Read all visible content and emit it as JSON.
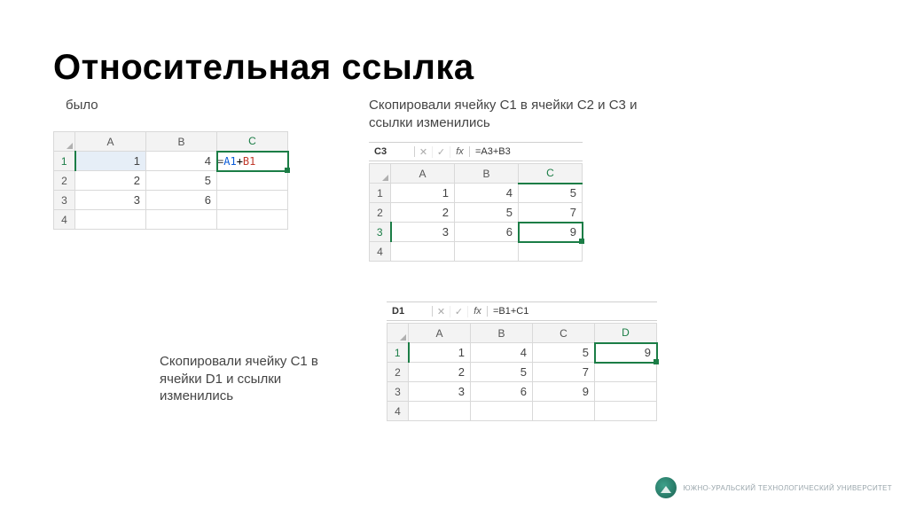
{
  "title": "Относительная ссылка",
  "captions": {
    "was": "было",
    "copied_c2c3": "Скопировали ячейку С1 в ячейки С2 и С3 и ссылки изменились",
    "copied_d1": "Скопировали ячейку С1 в ячейки D1 и ссылки изменились"
  },
  "ex1": {
    "cols": [
      "A",
      "B",
      "C"
    ],
    "rows": [
      "1",
      "2",
      "3",
      "4"
    ],
    "data": [
      [
        "1",
        "4",
        "=A1+B1"
      ],
      [
        "2",
        "5",
        ""
      ],
      [
        "3",
        "6",
        ""
      ],
      [
        "",
        "",
        ""
      ]
    ],
    "formula_parts": {
      "eq": "=",
      "r1": "A1",
      "plus": "+",
      "r2": "B1"
    }
  },
  "ex2": {
    "namebox": "C3",
    "formula": "=A3+B3",
    "cols": [
      "A",
      "B",
      "C"
    ],
    "rows": [
      "1",
      "2",
      "3",
      "4"
    ],
    "data": [
      [
        "1",
        "4",
        "5"
      ],
      [
        "2",
        "5",
        "7"
      ],
      [
        "3",
        "6",
        "9"
      ],
      [
        "",
        "",
        ""
      ]
    ]
  },
  "ex3": {
    "namebox": "D1",
    "formula": "=B1+C1",
    "cols": [
      "A",
      "B",
      "C",
      "D"
    ],
    "rows": [
      "1",
      "2",
      "3",
      "4"
    ],
    "data": [
      [
        "1",
        "4",
        "5",
        "9"
      ],
      [
        "2",
        "5",
        "7",
        ""
      ],
      [
        "3",
        "6",
        "9",
        ""
      ],
      [
        "",
        "",
        "",
        ""
      ]
    ]
  },
  "footer": "ЮЖНО-УРАЛЬСКИЙ ТЕХНОЛОГИЧЕСКИЙ УНИВЕРСИТЕТ"
}
